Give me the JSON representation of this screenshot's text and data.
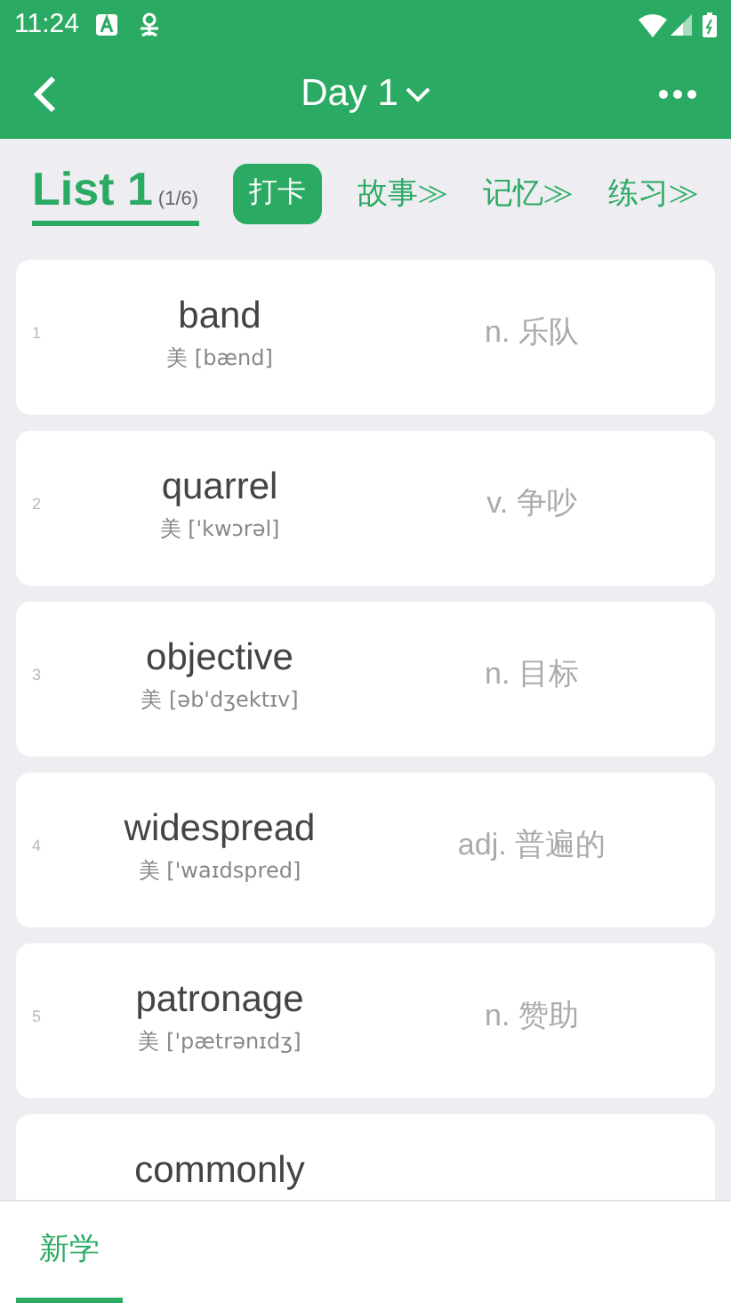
{
  "status_bar": {
    "time": "11:24"
  },
  "header": {
    "title": "Day 1"
  },
  "nav": [
    {
      "kind": "list",
      "label": "List 1",
      "count": "(1/6)",
      "selected": true
    },
    {
      "kind": "pill",
      "label": "打卡"
    },
    {
      "kind": "link",
      "label": "故事≫"
    },
    {
      "kind": "link",
      "label": "记忆≫"
    },
    {
      "kind": "link",
      "label": "练习≫"
    }
  ],
  "words": [
    {
      "number": "1",
      "word": "band",
      "phonetic": "美 [bænd]",
      "meaning": "n. 乐队"
    },
    {
      "number": "2",
      "word": "quarrel",
      "phonetic": "美 ['kwɔrəl]",
      "meaning": "v. 争吵"
    },
    {
      "number": "3",
      "word": "objective",
      "phonetic": "美 [əb'dʒektɪv]",
      "meaning": "n. 目标"
    },
    {
      "number": "4",
      "word": "widespread",
      "phonetic": "美 ['waɪdspred]",
      "meaning": "adj. 普遍的"
    },
    {
      "number": "5",
      "word": "patronage",
      "phonetic": "美 ['pætrənɪdʒ]",
      "meaning": "n. 赞助"
    },
    {
      "word": "commonly"
    }
  ],
  "bottom_tabs": [
    {
      "label": "新学",
      "selected": true
    }
  ]
}
